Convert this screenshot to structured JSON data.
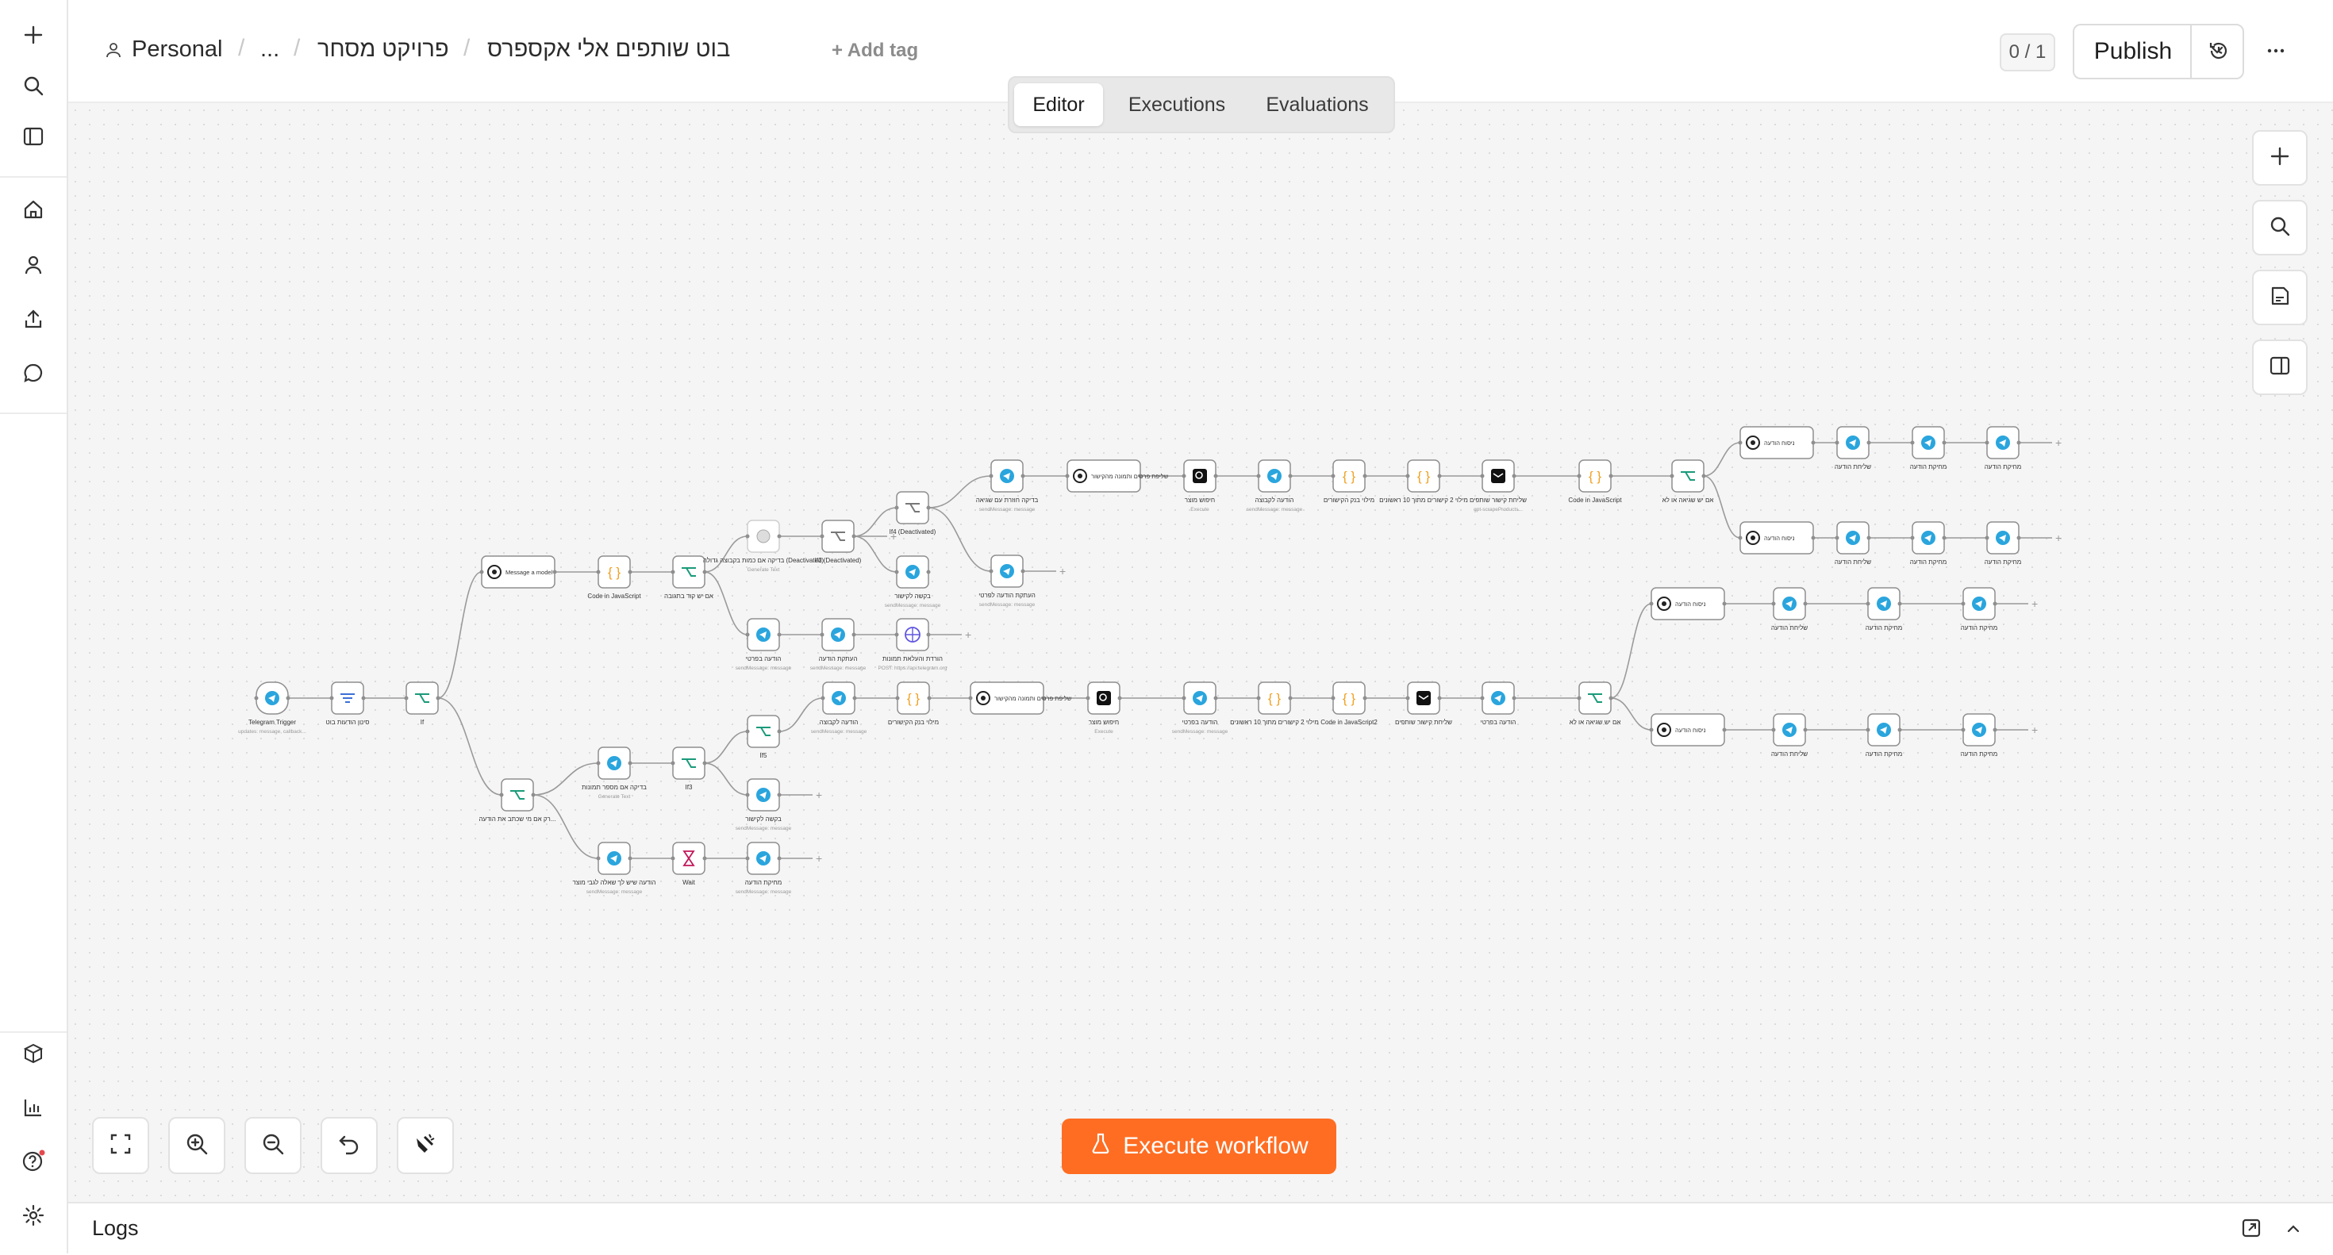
{
  "breadcrumb": {
    "owner": "Personal",
    "ellipsis": "...",
    "folder": "פרויקט מסחר",
    "workflow_name": "בוט שותפים אלי אקספרס",
    "add_tag": "+ Add tag"
  },
  "header": {
    "counter": "0 / 1",
    "publish_label": "Publish"
  },
  "tabs": [
    {
      "label": "Editor",
      "active": true
    },
    {
      "label": "Executions",
      "active": false
    },
    {
      "label": "Evaluations",
      "active": false
    }
  ],
  "execute_button": {
    "label": "Execute workflow"
  },
  "logs": {
    "label": "Logs"
  },
  "colors": {
    "accent": "#ff6d22",
    "telegram": "#2aa5dd",
    "code": "#f0a020",
    "switch": "#1a9a7a",
    "http": "#5f55e0"
  },
  "icons": {
    "sidebar": [
      "plus-icon",
      "search-icon",
      "panel-icon",
      "home-icon",
      "user-icon",
      "share-icon",
      "chat-icon",
      "cube-icon",
      "chart-icon",
      "help-icon",
      "settings-icon"
    ],
    "canvas_right": [
      "zoom-add-icon",
      "canvas-search-icon",
      "sticky-note-icon",
      "side-panel-icon"
    ],
    "canvas_bottom": [
      "fit-view-icon",
      "zoom-in-icon",
      "zoom-out-icon",
      "undo-icon",
      "tidy-icon"
    ]
  },
  "nodes": [
    {
      "name": "telegram-trigger",
      "icon": "telegram",
      "label": "Telegram Trigger",
      "sub": "updates: message, callback..."
    },
    {
      "name": "filter-1",
      "icon": "filter",
      "label": "סינון הודעות בוט"
    },
    {
      "name": "switch-main",
      "icon": "switch",
      "label": "If"
    },
    {
      "name": "message-model",
      "icon": "openai",
      "label": "Message a model",
      "sub": "Generate Text"
    },
    {
      "name": "code-js-1",
      "icon": "code",
      "label": "Code in JavaScript"
    },
    {
      "name": "switch-2",
      "icon": "switch",
      "label": "אם יש קוד בתגובה"
    },
    {
      "name": "deactivated-1",
      "icon": "disabled",
      "label": "בדיקה אם כמות בקבוצה גדולה (Deactivated)",
      "sub": "Generate Text"
    },
    {
      "name": "if-deactivated",
      "icon": "if",
      "label": "If2 (Deactivated)"
    },
    {
      "name": "if-3-deactivated",
      "icon": "if",
      "label": "If4 (Deactivated)"
    },
    {
      "name": "tg-a",
      "icon": "telegram",
      "label": "הודעה בפרטי",
      "sub": "sendMessage: message"
    },
    {
      "name": "tg-b",
      "icon": "telegram",
      "label": "העתקת הודעה",
      "sub": "sendMessage: message"
    },
    {
      "name": "openai-big-1",
      "icon": "openai",
      "label": "שליפת פרטים ותמונה מהקישור",
      "sub": "Generate Text"
    },
    {
      "name": "ai-search-1",
      "icon": "search",
      "label": "חיפוש מוצר",
      "sub": "Execute"
    },
    {
      "name": "tg-c",
      "icon": "telegram",
      "label": "הודעה לקבוצה",
      "sub": "sendMessage: message"
    },
    {
      "name": "code-2",
      "icon": "code",
      "label": "מילוי בנק הקישורים"
    },
    {
      "name": "code-3",
      "icon": "code",
      "label": "מילוי 2 קישורים מתוך 10 ראשונים"
    },
    {
      "name": "email-1",
      "icon": "email",
      "label": "שליחת קישור שותפים",
      "sub": "gpt-scrapeProducts..."
    },
    {
      "name": "code-js-4",
      "icon": "code",
      "label": "Code in JavaScript"
    },
    {
      "name": "switch-top",
      "icon": "switch",
      "label": "אם יש שגיאה או לא"
    },
    {
      "name": "tg-d",
      "icon": "telegram",
      "label": "בדיקה חוזרת עם שגיאה",
      "sub": "sendMessage: message"
    },
    {
      "name": "tg-e",
      "icon": "telegram",
      "label": "העתקת הודעה לפרטי",
      "sub": "sendMessage: message"
    },
    {
      "name": "tg-f",
      "icon": "telegram",
      "label": "בקשה לקישור",
      "sub": "sendMessage: message"
    },
    {
      "name": "http-1",
      "icon": "globe",
      "label": "הורדת והעלאת תמונות",
      "sub": "POST: https://api.telegram.org"
    },
    {
      "name": "openai-2",
      "icon": "openai",
      "label": "שליפת פרטים ותמונה מהקישור",
      "sub": "Generate Text"
    },
    {
      "name": "ai-search-2",
      "icon": "search",
      "label": "חיפוש מוצר",
      "sub": "Execute"
    },
    {
      "name": "tg-g",
      "icon": "telegram",
      "label": "הודעה לקבוצה",
      "sub": "sendMessage: message"
    },
    {
      "name": "code-5",
      "icon": "code",
      "label": "מילוי בנק הקישורים"
    },
    {
      "name": "code-6",
      "icon": "code",
      "label": "מילוי 2 קישורים מתוך 10 ראשונים"
    },
    {
      "name": "email-2",
      "icon": "email",
      "label": "שליחת קישור שותפים"
    },
    {
      "name": "code-js-7",
      "icon": "code",
      "label": "Code in JavaScript2"
    },
    {
      "name": "switch-bottom",
      "icon": "switch",
      "label": "אם יש שגיאה או לא"
    },
    {
      "name": "switch-left",
      "icon": "switch",
      "label": "רק אם מי שכתב את הודעה..."
    },
    {
      "name": "tg-h",
      "icon": "telegram",
      "label": "בדיקה אם מספר תמונות",
      "sub": "Generate Text"
    },
    {
      "name": "switch-3",
      "icon": "switch",
      "label": "If3"
    },
    {
      "name": "switch-4",
      "icon": "switch",
      "label": "If5"
    },
    {
      "name": "tg-i",
      "icon": "telegram",
      "label": "הודעה בפרטי",
      "sub": "sendMessage: message"
    },
    {
      "name": "tg-j",
      "icon": "telegram",
      "label": "הודעה בפרטי"
    },
    {
      "name": "tg-k",
      "icon": "telegram",
      "label": "בקשה לקישור",
      "sub": "sendMessage: message"
    },
    {
      "name": "tg-l",
      "icon": "telegram",
      "label": "הודעה שיש לך שאלה לגבי מוצר",
      "sub": "sendMessage: message"
    },
    {
      "name": "wait-1",
      "icon": "wait",
      "label": "Wait"
    },
    {
      "name": "tg-m",
      "icon": "telegram",
      "label": "מחיקת הודעה",
      "sub": "sendMessage: message"
    },
    {
      "name": "ai-r1",
      "icon": "openai",
      "label": "ניסוח הודעה",
      "sub": "Message Model"
    },
    {
      "name": "ai-r2",
      "icon": "openai",
      "label": "ניסוח הודעה",
      "sub": "Message Model"
    },
    {
      "name": "ai-r3",
      "icon": "openai",
      "label": "ניסוח הודעה",
      "sub": "Message Model"
    },
    {
      "name": "ai-r4",
      "icon": "openai",
      "label": "ניסוח הודעה",
      "sub": "Message Model"
    },
    {
      "name": "tg-r1a",
      "icon": "telegram",
      "label": "שליחת הודעה"
    },
    {
      "name": "tg-r1b",
      "icon": "telegram",
      "label": "מחיקת הודעה"
    },
    {
      "name": "tg-r1c",
      "icon": "telegram",
      "label": "מחיקת הודעה"
    },
    {
      "name": "tg-r2a",
      "icon": "telegram",
      "label": "שליחת הודעה"
    },
    {
      "name": "tg-r2b",
      "icon": "telegram",
      "label": "מחיקת הודעה"
    },
    {
      "name": "tg-r2c",
      "icon": "telegram",
      "label": "מחיקת הודעה"
    },
    {
      "name": "tg-r3a",
      "icon": "telegram",
      "label": "שליחת הודעה"
    },
    {
      "name": "tg-r3b",
      "icon": "telegram",
      "label": "מחיקת הודעה"
    },
    {
      "name": "tg-r3c",
      "icon": "telegram",
      "label": "מחיקת הודעה"
    },
    {
      "name": "tg-r4a",
      "icon": "telegram",
      "label": "שליחת הודעה"
    },
    {
      "name": "tg-r4b",
      "icon": "telegram",
      "label": "מחיקת הודעה"
    },
    {
      "name": "tg-r4c",
      "icon": "telegram",
      "label": "מחיקת הודעה"
    }
  ]
}
